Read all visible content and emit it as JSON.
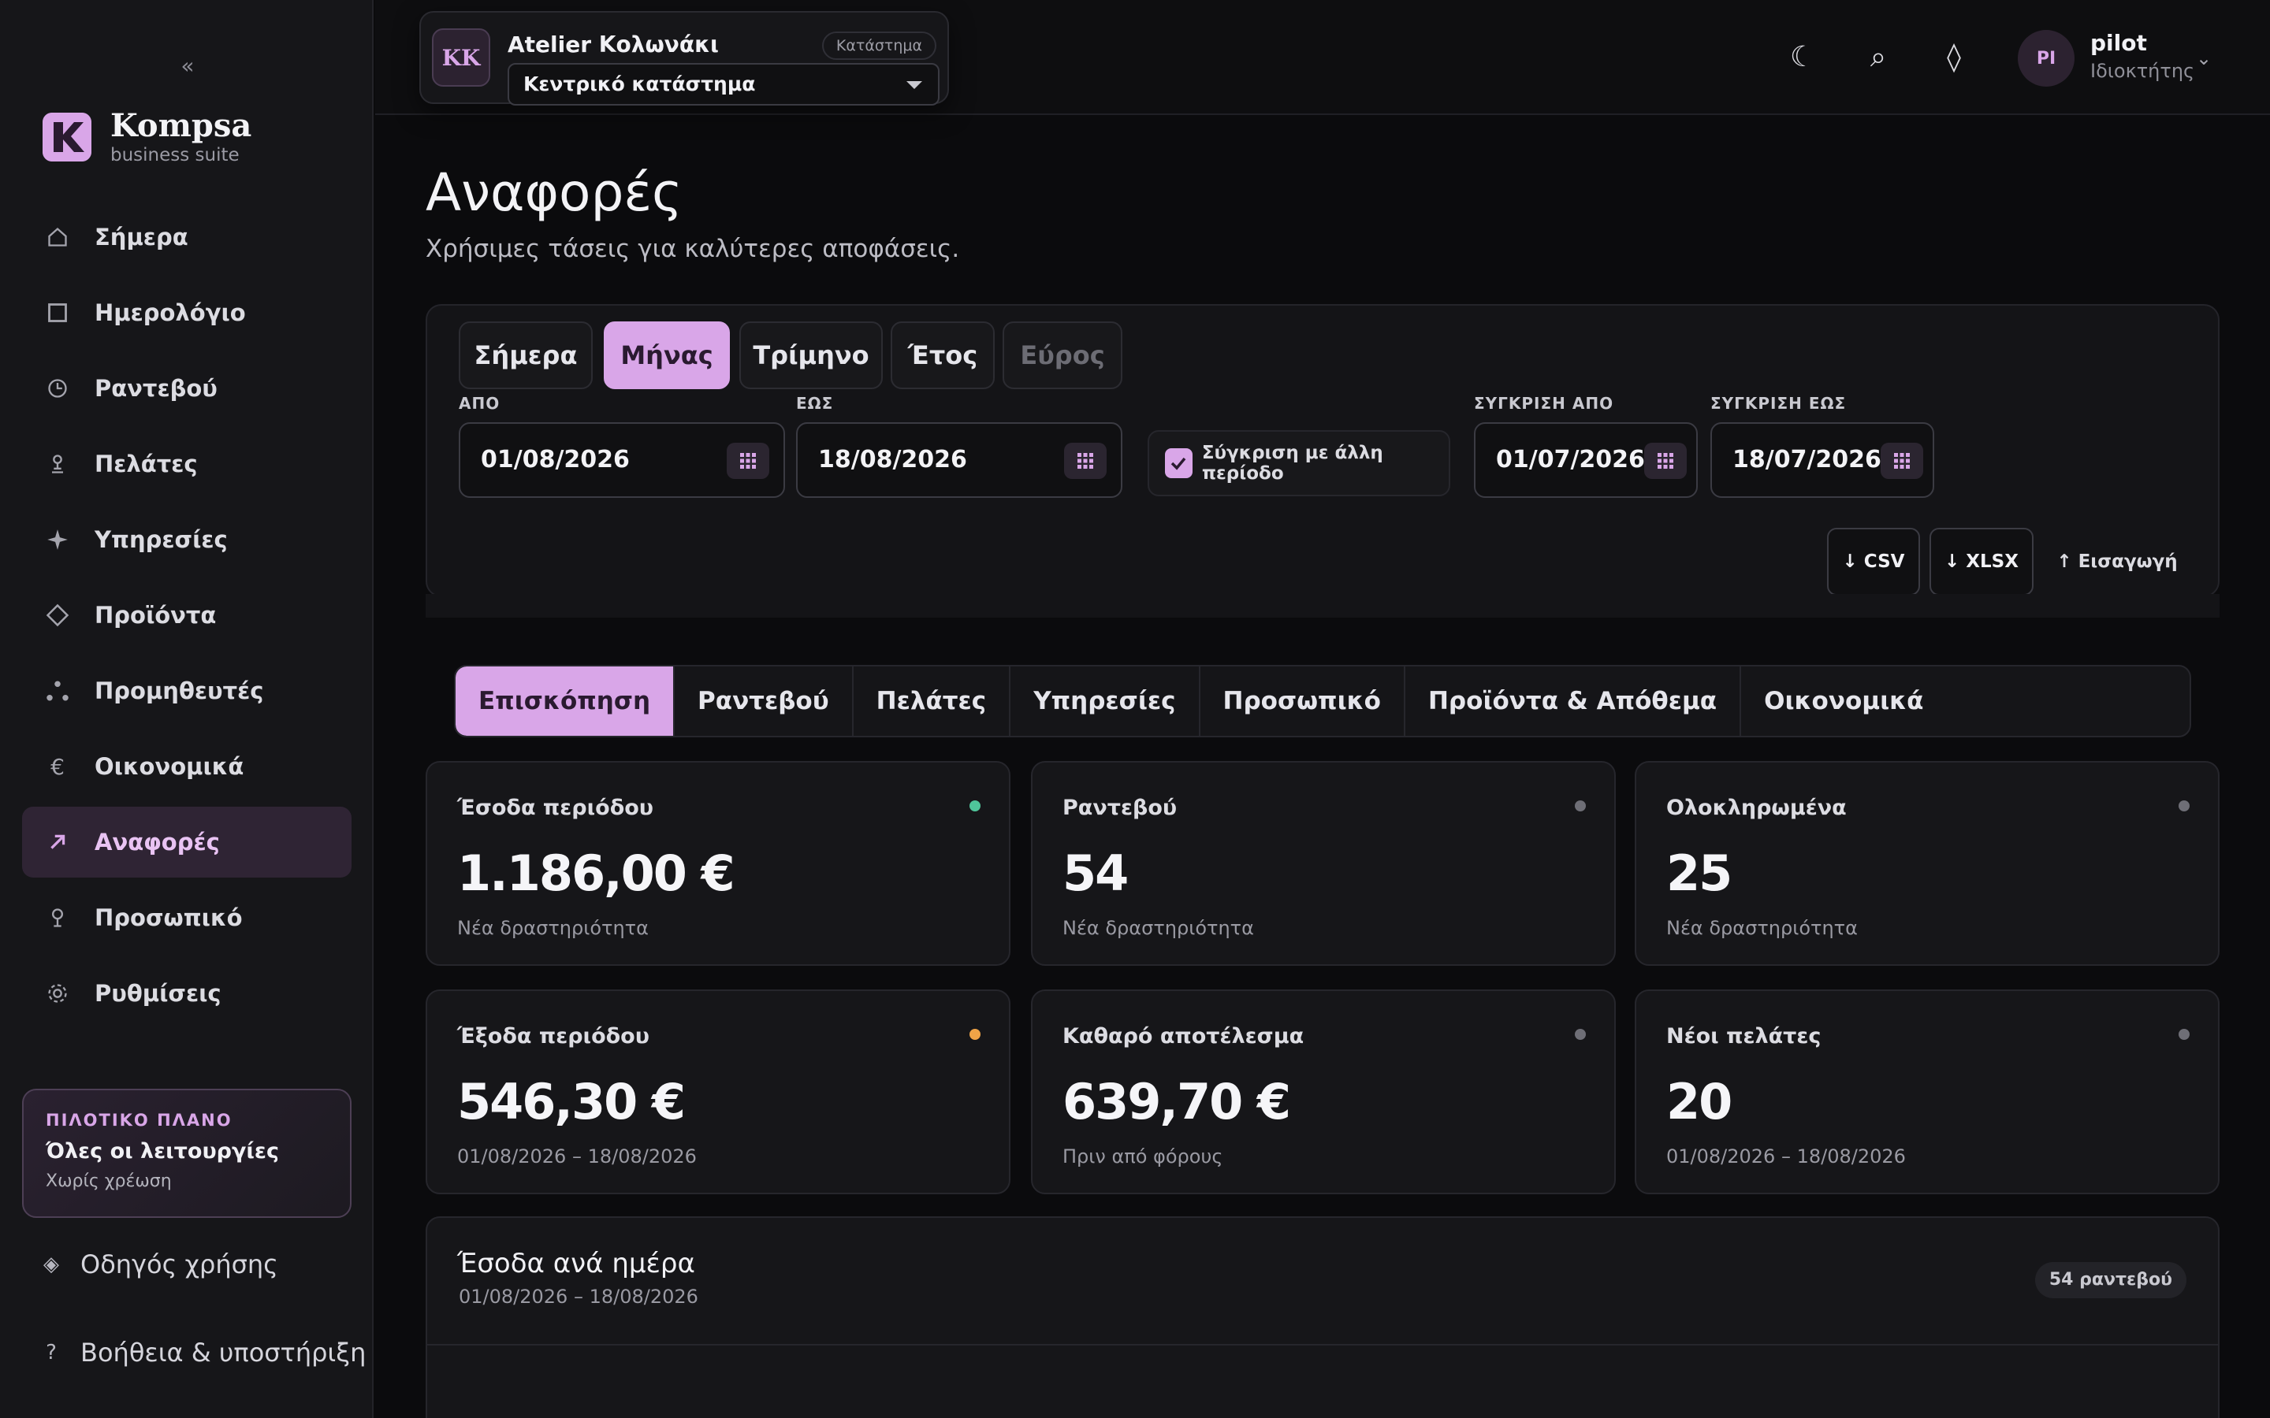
{
  "sidebar": {
    "collapse_glyph": "«",
    "brand": {
      "name": "Kompsa",
      "sub": "business suite",
      "accent": "#d9a6e8"
    },
    "items": [
      {
        "label": "Σήμερα",
        "icon": "home-icon"
      },
      {
        "label": "Ημερολόγιο",
        "icon": "calendar-icon"
      },
      {
        "label": "Ραντεβού",
        "icon": "clock-icon"
      },
      {
        "label": "Πελάτες",
        "icon": "user-icon"
      },
      {
        "label": "Υπηρεσίες",
        "icon": "sparkle-icon"
      },
      {
        "label": "Προϊόντα",
        "icon": "diamond-icon"
      },
      {
        "label": "Προμηθευτές",
        "icon": "dots-icon"
      },
      {
        "label": "Οικονομικά",
        "icon": "euro-icon"
      },
      {
        "label": "Αναφορές",
        "icon": "trend-arrow-icon",
        "active": true
      },
      {
        "label": "Προσωπικό",
        "icon": "staff-icon"
      },
      {
        "label": "Ρυθμίσεις",
        "icon": "gear-icon"
      }
    ],
    "plan": {
      "kicker": "ΠΙΛΟΤΙΚΟ ΠΛΑΝΟ",
      "title": "Όλες οι λειτουργίες",
      "sub": "Χωρίς χρέωση"
    },
    "guide": {
      "label": "Οδηγός χρήσης",
      "glyph": "◈"
    },
    "help": {
      "label": "Βοήθεια & υποστήριξη",
      "glyph": "?"
    }
  },
  "topbar": {
    "store": {
      "initials": "KK",
      "name": "Atelier Κολωνάκι",
      "badge": "Κατάστημα",
      "selected": "Κεντρικό κατάστημα"
    },
    "icons": {
      "theme": "☾",
      "search": "⌕",
      "diamond": "◊"
    },
    "user": {
      "initials": "PI",
      "name": "pilot",
      "role": "Ιδιοκτήτης",
      "caret": "⌄"
    }
  },
  "page": {
    "title": "Αναφορές",
    "subtitle": "Χρήσιμες τάσεις για καλύτερες αποφάσεις."
  },
  "filters": {
    "periods": [
      {
        "label": "Σήμερα"
      },
      {
        "label": "Μήνας",
        "active": true
      },
      {
        "label": "Τρίμηνο"
      },
      {
        "label": "Έτος"
      },
      {
        "label": "Εύρος",
        "disabled": true
      }
    ],
    "from_label": "ΑΠΟ",
    "from_value": "01/08/2026",
    "to_label": "ΕΩΣ",
    "to_value": "18/08/2026",
    "compare_label": "Σύγκριση με άλλη περίοδο",
    "compare_checked": true,
    "compare_from_label": "ΣΥΓΚΡΙΣΗ ΑΠΟ",
    "compare_from_value": "01/07/2026",
    "compare_to_label": "ΣΥΓΚΡΙΣΗ ΕΩΣ",
    "compare_to_value": "18/07/2026",
    "csv_label": "↓ CSV",
    "xlsx_label": "↓ XLSX",
    "import_label": "↑ Εισαγωγή"
  },
  "report_tabs": [
    {
      "label": "Επισκόπηση",
      "active": true
    },
    {
      "label": "Ραντεβού"
    },
    {
      "label": "Πελάτες"
    },
    {
      "label": "Υπηρεσίες"
    },
    {
      "label": "Προσωπικό"
    },
    {
      "label": "Προϊόντα & Απόθεμα"
    },
    {
      "label": "Οικονομικά"
    }
  ],
  "kpis": [
    {
      "title": "Έσοδα περιόδου",
      "value": "1.186,00 €",
      "note": "Νέα δραστηριότητα",
      "dot": "#4fc59a"
    },
    {
      "title": "Ραντεβού",
      "value": "54",
      "note": "Νέα δραστηριότητα",
      "dot": "#6e6e76"
    },
    {
      "title": "Ολοκληρωμένα",
      "value": "25",
      "note": "Νέα δραστηριότητα",
      "dot": "#6e6e76"
    },
    {
      "title": "Έξοδα περιόδου",
      "value": "546,30 €",
      "note": "01/08/2026 – 18/08/2026",
      "dot": "#f0a447"
    },
    {
      "title": "Καθαρό αποτέλεσμα",
      "value": "639,70 €",
      "note": "Πριν από φόρους",
      "dot": "#6e6e76"
    },
    {
      "title": "Νέοι πελάτες",
      "value": "20",
      "note": "01/08/2026 – 18/08/2026",
      "dot": "#6e6e76"
    }
  ],
  "chart": {
    "title": "Έσοδα ανά ημέρα",
    "range": "01/08/2026 – 18/08/2026",
    "badge": "54 ραντεβού"
  }
}
